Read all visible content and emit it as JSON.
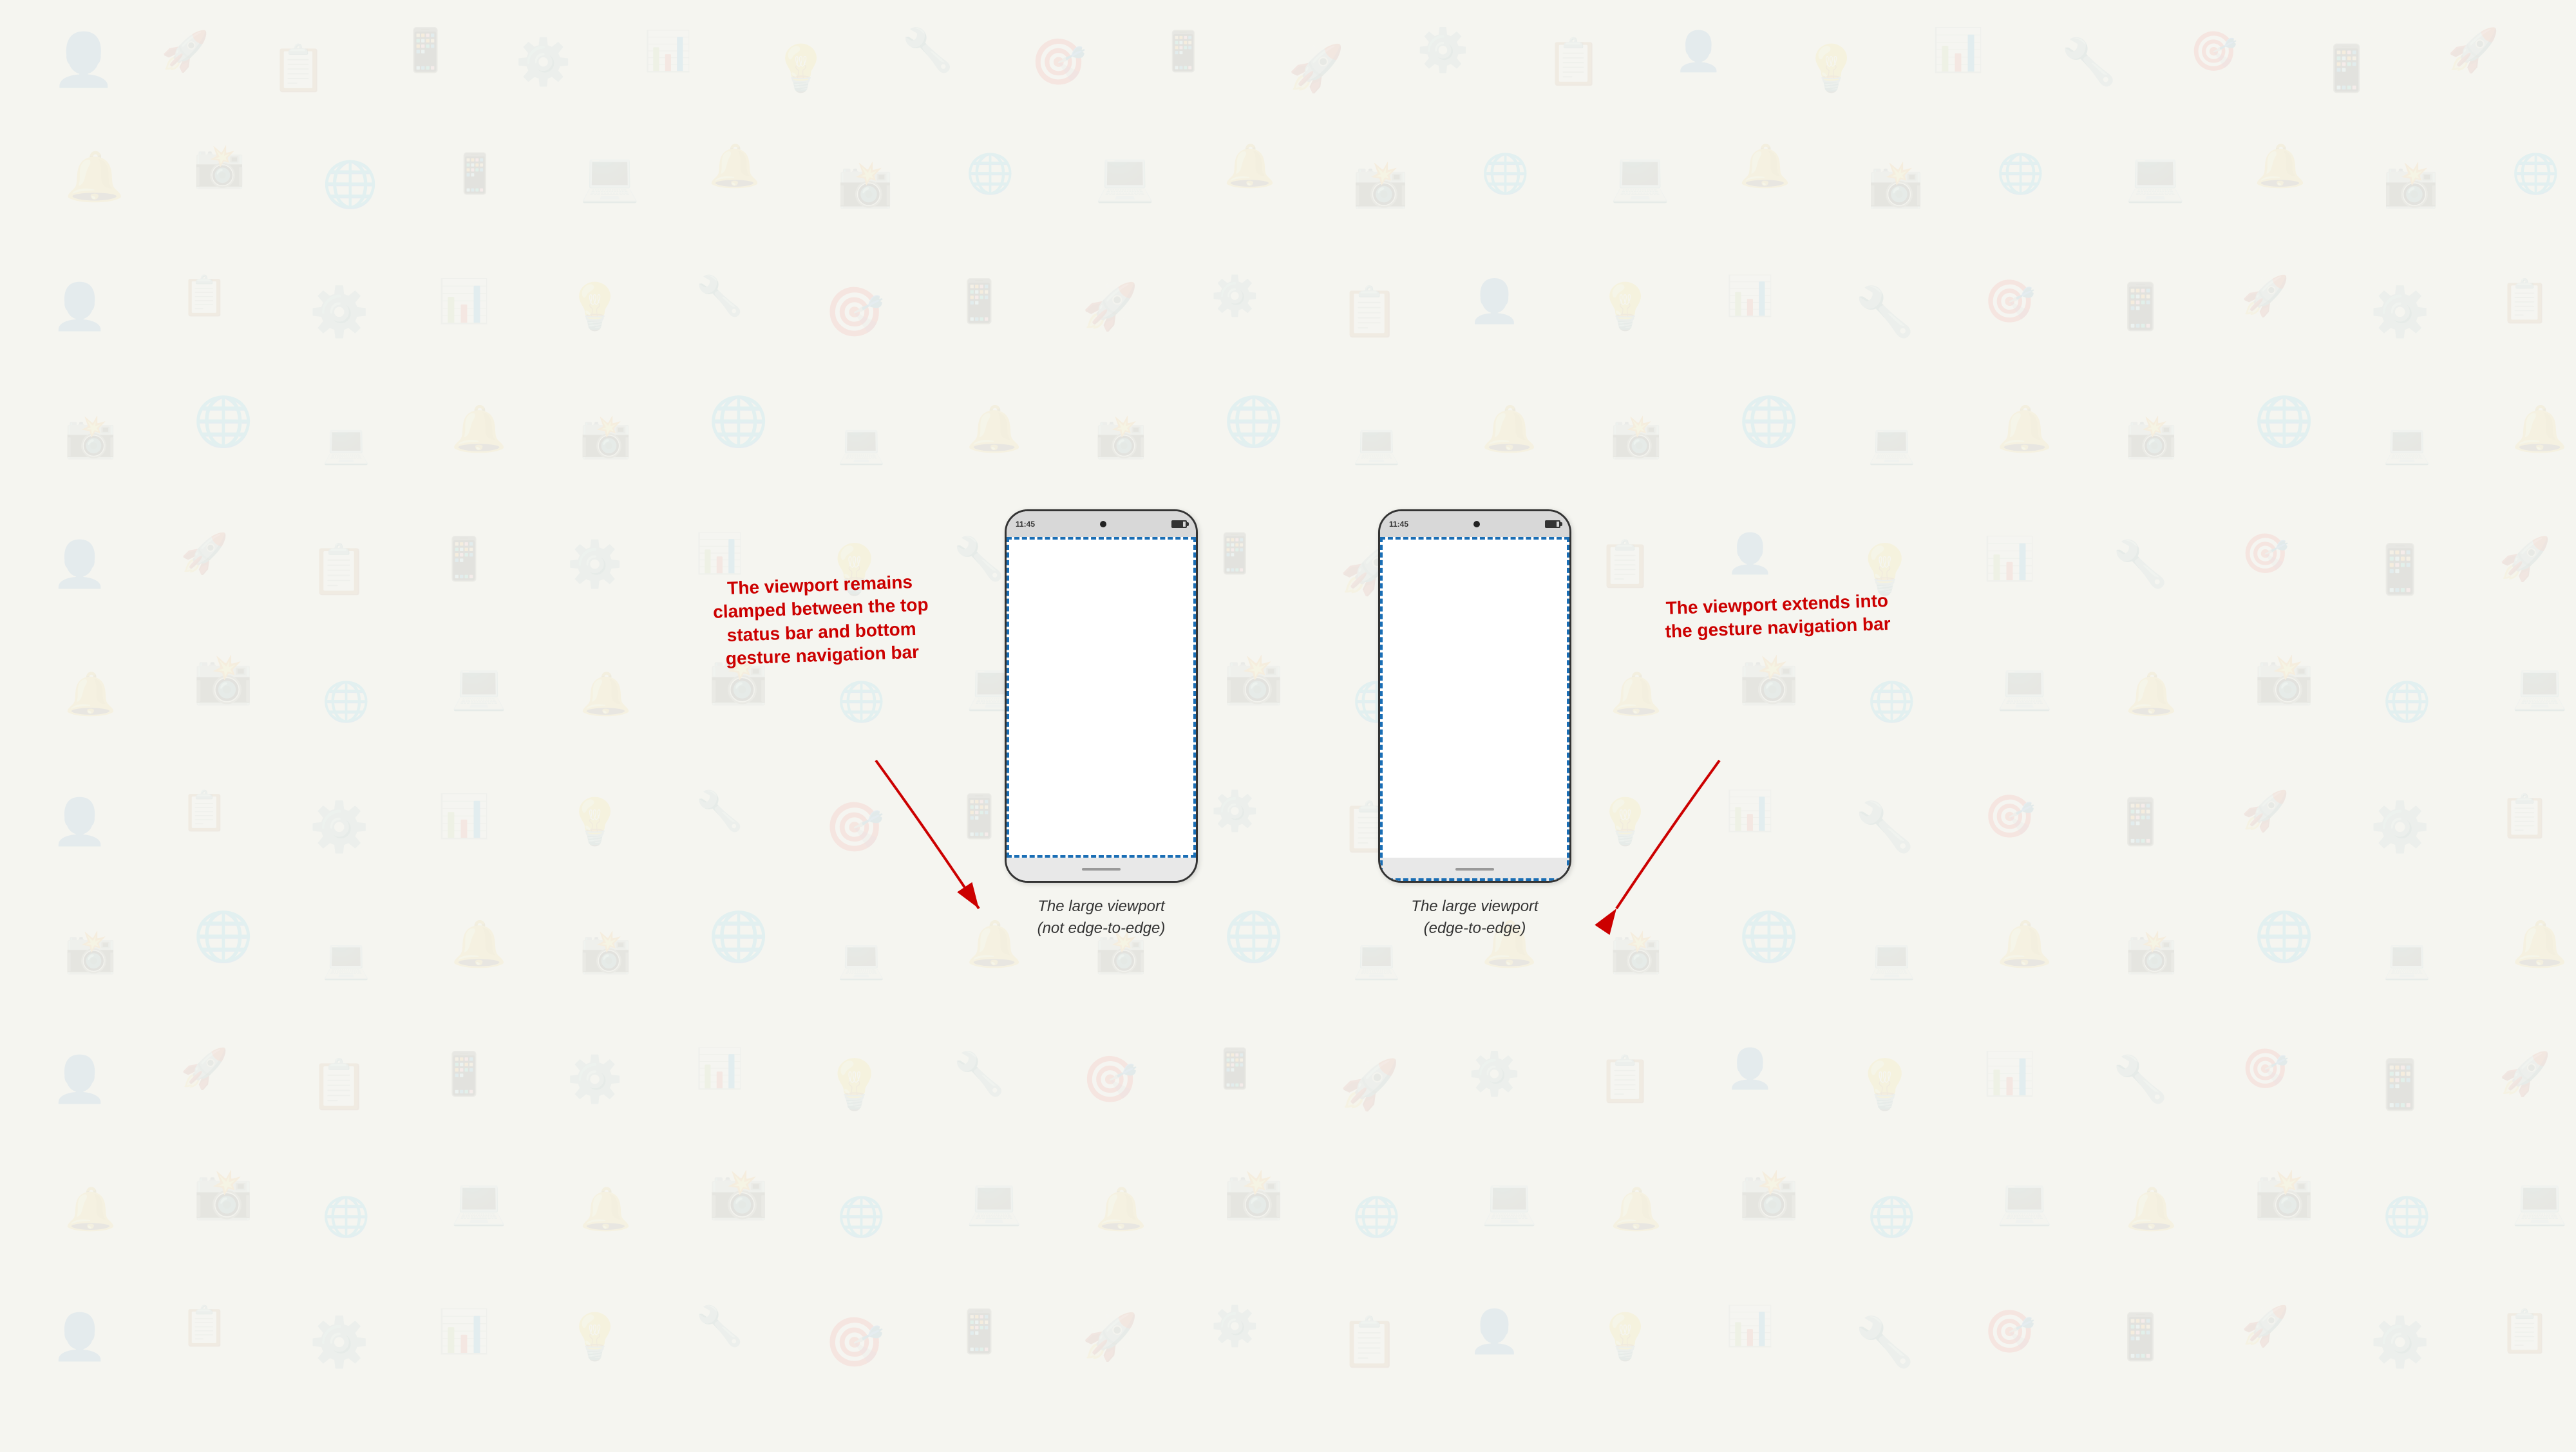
{
  "background": {
    "color": "#f5f5f0"
  },
  "phones": {
    "left": {
      "status_time": "11:45",
      "label_line1": "The large viewport",
      "label_line2": "(not edge-to-edge)",
      "viewport_type": "clamped"
    },
    "right": {
      "status_time": "11:45",
      "label_line1": "The large viewport",
      "label_line2": "(edge-to-edge)",
      "viewport_type": "edge-to-edge"
    }
  },
  "annotations": {
    "left": {
      "text": "The viewport remains clamped between the top status bar and bottom gesture navigation bar"
    },
    "right": {
      "text": "The viewport extends into the gesture navigation bar"
    }
  }
}
